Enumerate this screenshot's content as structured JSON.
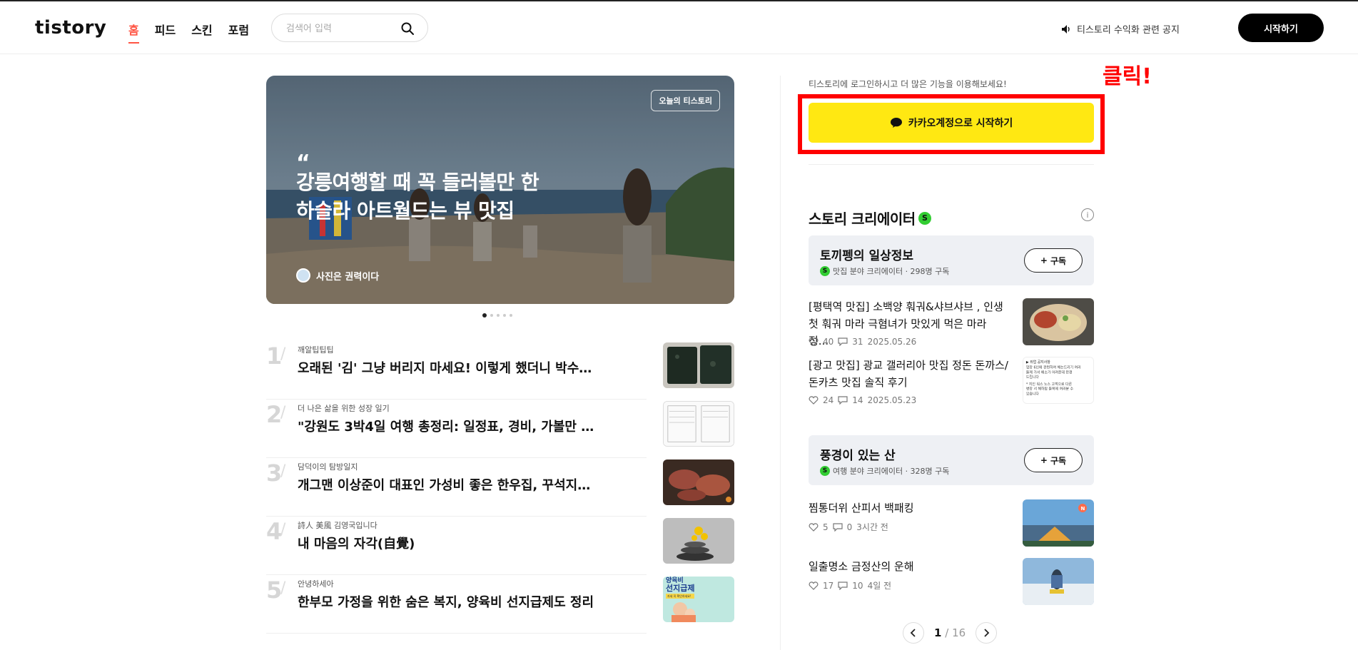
{
  "header": {
    "logo": "tistory",
    "nav": [
      "홈",
      "피드",
      "스킨",
      "포럼"
    ],
    "search_placeholder": "검색어 입력",
    "notice": "티스토리 수익화 관련 공지",
    "start_button": "시작하기"
  },
  "hero": {
    "badge": "오늘의 티스토리",
    "quote_mark": "“",
    "title": "강릉여행할 때 꼭 들러볼만 한 하슬라 아트월드는 뷰 맛집",
    "author": "사진은 권력이다",
    "slides": 5,
    "active_slide": 1
  },
  "ranking": [
    {
      "num": "1",
      "blog": "깨알팁팁팁",
      "title": "오래된 '김' 그냥 버리지 마세요! 이렇게 했더니 박수가 ..."
    },
    {
      "num": "2",
      "blog": "더 나은 삶을 위한 성장 일기",
      "title": "\"강원도 3박4일 여행 총정리: 일정표, 경비, 가볼만 한 ..."
    },
    {
      "num": "3",
      "blog": "담덕이의 탐방일지",
      "title": "개그맨 이상준이 대표인 가성비 좋은 한우집, 꾸석지돌..."
    },
    {
      "num": "4",
      "blog": "詩人 美風 김영국입니다",
      "title": "내 마음의 자각(自覺)"
    },
    {
      "num": "5",
      "blog": "안녕하세아",
      "title": "한부모 가정을 위한 숨은 복지, 양육비 선지급제도 정리"
    }
  ],
  "sidebar": {
    "login_text": "티스토리에 로그인하시고 더 많은 기능을 이용해보세요!",
    "kakao_button": "카카오계정으로 시작하기",
    "annotation": "클릭!",
    "creator_heading": "스토리 크리에이터",
    "s_badge": "S",
    "info": "i",
    "creators": [
      {
        "name": "토끼펭의 일상정보",
        "meta": "맛집 분야 크리에이터 · 298명 구독",
        "subscribe": "구독",
        "posts": [
          {
            "title": "[평택역 맛집] 소백양 훠궈&샤브샤브 , 인생 첫 훠궈 마라 극혐녀가 맛있게 먹은 마라 정...",
            "likes": "40",
            "comments": "31",
            "date": "2025.05.26"
          },
          {
            "title": "[광고 맛집] 광교 갤러리아 맛집 정돈 돈까스/돈카츠 맛집 솔직 후기",
            "likes": "24",
            "comments": "14",
            "date": "2025.05.23"
          }
        ]
      },
      {
        "name": "풍경이 있는 산",
        "meta": "여행 분야 크리에이터 · 328명 구독",
        "subscribe": "구독",
        "posts": [
          {
            "title": "찜통더위 산피서 백패킹",
            "likes": "5",
            "comments": "0",
            "date": "3시간 전",
            "new_badge": "N"
          },
          {
            "title": "일출명소 금정산의 운해",
            "likes": "17",
            "comments": "10",
            "date": "4일 전"
          }
        ]
      }
    ],
    "pager": {
      "current": "1",
      "separator": "/",
      "total": "16"
    }
  },
  "thumb_text": {
    "notice_lines": [
      "▶ 취업 공지사항",
      "업장 6인에 관련하여 헤는드리기 여러",
      "들께 가서 배소가 어려운데 만경",
      "드립니다",
      "* 지인 워스 노스 고객으로 다른",
      "병장 서 해하탑 들목에 여러분 수",
      "있습니다"
    ],
    "poster_top": "양육비",
    "poster_mid": "선지급제",
    "poster_bottom": "자세 꼭 확인하세요!"
  },
  "colors": {
    "accent": "#ff5544",
    "kakao": "#ffe812",
    "annotation_red": "#ff0000",
    "creator_badge": "#32cd32"
  }
}
